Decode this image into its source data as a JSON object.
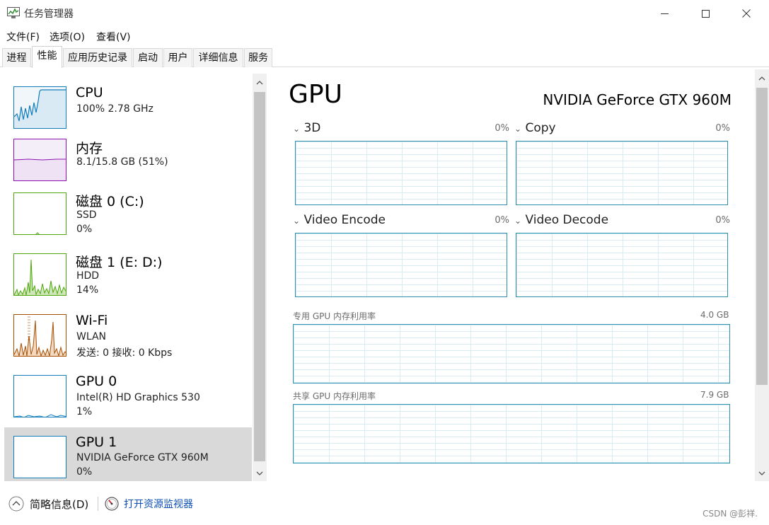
{
  "window": {
    "title": "任务管理器",
    "controls": {
      "minimize": "—",
      "maximize": "☐",
      "close": "✕"
    }
  },
  "menu": [
    "文件(F)",
    "选项(O)",
    "查看(V)"
  ],
  "tabs": [
    "进程",
    "性能",
    "应用历史记录",
    "启动",
    "用户",
    "详细信息",
    "服务"
  ],
  "active_tab": "性能",
  "sidebar": {
    "items": [
      {
        "title": "CPU",
        "line1": "100%  2.78 GHz",
        "line2": "",
        "color": "#117dbb"
      },
      {
        "title": "内存",
        "line1": "8.1/15.8 GB (51%)",
        "line2": "",
        "color": "#8b12ae"
      },
      {
        "title": "磁盘 0 (C:)",
        "line1": "SSD",
        "line2": "0%",
        "color": "#4da60c"
      },
      {
        "title": "磁盘 1 (E: D:)",
        "line1": "HDD",
        "line2": "14%",
        "color": "#4da60c"
      },
      {
        "title": "Wi-Fi",
        "line1": "WLAN",
        "line2": "发送: 0 接收: 0 Kbps",
        "color": "#a74f01"
      },
      {
        "title": "GPU 0",
        "line1": "Intel(R) HD Graphics 530",
        "line2": "1%",
        "color": "#117dbb"
      },
      {
        "title": "GPU 1",
        "line1": "NVIDIA GeForce GTX 960M",
        "line2": "0%",
        "color": "#117dbb"
      }
    ],
    "selected_index": 6
  },
  "main": {
    "title": "GPU",
    "model": "NVIDIA GeForce GTX 960M",
    "engines": [
      {
        "name": "3D",
        "percent": "0%"
      },
      {
        "name": "Copy",
        "percent": "0%"
      },
      {
        "name": "Video Encode",
        "percent": "0%"
      },
      {
        "name": "Video Decode",
        "percent": "0%"
      }
    ],
    "dedicated_memory": {
      "label": "专用 GPU 内存利用率",
      "max": "4.0 GB"
    },
    "shared_memory": {
      "label": "共享 GPU 内存利用率",
      "max": "7.9 GB"
    }
  },
  "footer": {
    "summary_label": "简略信息(D)",
    "resource_monitor_label": "打开资源监视器"
  },
  "watermark": "CSDN @彭祥."
}
